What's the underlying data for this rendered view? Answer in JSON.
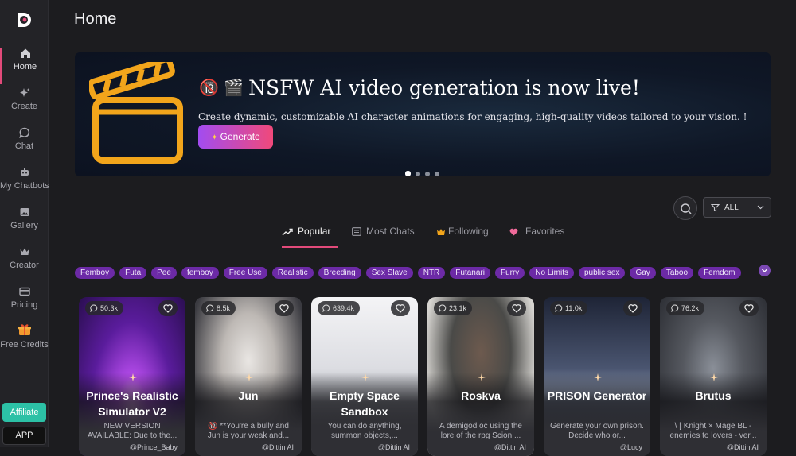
{
  "page": {
    "title": "Home"
  },
  "sidebar": {
    "items": [
      {
        "label": "Home",
        "icon": "home-icon",
        "active": true
      },
      {
        "label": "Create",
        "icon": "sparkle-icon"
      },
      {
        "label": "Chat",
        "icon": "chat-bubble-icon"
      },
      {
        "label": "My Chatbots",
        "icon": "robot-icon"
      },
      {
        "label": "Gallery",
        "icon": "image-icon"
      },
      {
        "label": "Creator",
        "icon": "crown-icon"
      },
      {
        "label": "Pricing",
        "icon": "card-icon"
      },
      {
        "label": "Free Credits",
        "icon": "gift-icon"
      }
    ],
    "affiliate_label": "Affiliate",
    "app_label": "APP"
  },
  "banner": {
    "emoji": "🔞 🎬",
    "title": "NSFW AI video generation is now live!",
    "description": "Create dynamic, customizable AI character animations for engaging, high-quality videos tailored to your vision. !",
    "button_label": "Generate",
    "slide_count": 4,
    "active_slide": 1
  },
  "filter": {
    "selected": "ALL"
  },
  "tabs": [
    {
      "label": "Popular",
      "icon": "trending-icon",
      "active": true
    },
    {
      "label": "Most Chats",
      "icon": "list-icon"
    },
    {
      "label": "Following",
      "icon": "crown-icon"
    },
    {
      "label": "Favorites",
      "icon": "heart-icon"
    }
  ],
  "tags": [
    "Femboy",
    "Futa",
    "Pee",
    "femboy",
    "Free Use",
    "Realistic",
    "Breeding",
    "Sex Slave",
    "NTR",
    "Futanari",
    "Furry",
    "No Limits",
    "public sex",
    "Gay",
    "Taboo",
    "Femdom"
  ],
  "cards": [
    {
      "count": "50.3k",
      "name": "Prince's Realistic Simulator V2",
      "desc": "NEW VERSION AVAILABLE: Due to the...",
      "author": "@Prince_Baby"
    },
    {
      "count": "8.5k",
      "name": "Jun",
      "desc": "🔞 **You're a bully and Jun is your weak and...",
      "author": "@Dittin AI"
    },
    {
      "count": "639.4k",
      "name": "Empty Space Sandbox",
      "desc": "You can do anything, summon objects,...",
      "author": "@Dittin AI"
    },
    {
      "count": "23.1k",
      "name": "Roskva",
      "desc": "A demigod oc using the lore of the rpg Scion....",
      "author": "@Dittin AI"
    },
    {
      "count": "11.0k",
      "name": "PRISON Generator",
      "desc": "Generate your own prison. Decide who or...",
      "author": "@Lucy"
    },
    {
      "count": "76.2k",
      "name": "Brutus",
      "desc": "\\ [ Knight × Mage BL - enemies to lovers - ver...",
      "author": "@Dittin AI"
    }
  ],
  "colors": {
    "accent": "#e24a7a",
    "tag_bg": "#6c2aa6",
    "affiliate": "#2cc1a6",
    "clapper": "#f2a51b"
  }
}
